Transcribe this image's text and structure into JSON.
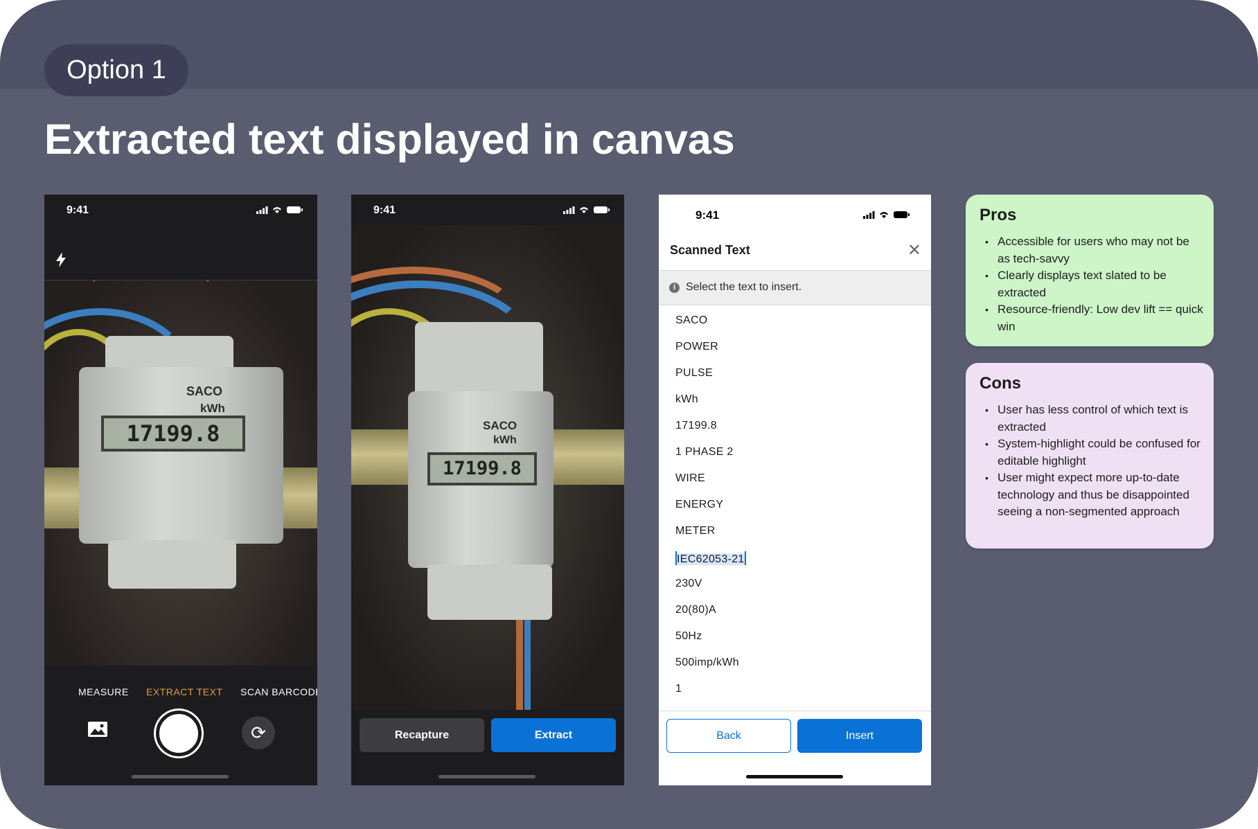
{
  "slide": {
    "option_label": "Option 1",
    "title": "Extracted text displayed in canvas"
  },
  "phone1": {
    "time": "9:41",
    "modes": [
      "MEASURE",
      "EXTRACT TEXT",
      "SCAN BARCODE"
    ],
    "active_mode": "EXTRACT TEXT",
    "meter_lcd": "17199.8",
    "meter_brand": "SACO",
    "meter_unit": "kWh"
  },
  "phone2": {
    "time": "9:41",
    "recapture_label": "Recapture",
    "extract_label": "Extract",
    "meter_lcd": "17199.8",
    "meter_brand": "SACO",
    "meter_unit": "kWh"
  },
  "phone3": {
    "time": "9:41",
    "sheet_title": "Scanned Text",
    "info_text": "Select the text to insert.",
    "items": [
      "SACO",
      "POWER",
      "PULSE",
      "kWh",
      "17199.8",
      "1 PHASE 2",
      "WIRE",
      "ENERGY",
      "METER",
      "IEC62053-21",
      "230V",
      "20(80)A",
      "50Hz",
      "500imp/kWh",
      "1"
    ],
    "selected_item": "IEC62053-21",
    "back_label": "Back",
    "insert_label": "Insert"
  },
  "pros": {
    "title": "Pros",
    "items": [
      "Accessible for users who may not be as tech-savvy",
      "Clearly displays text slated to be extracted",
      "Resource-friendly: Low dev lift == quick win"
    ]
  },
  "cons": {
    "title": "Cons",
    "items": [
      "User has less control of which text is extracted",
      "System-highlight could be confused for editable highlight",
      "User might expect more up-to-date technology and thus be disappointed seeing a non-segmented approach"
    ]
  },
  "colors": {
    "slide_bg": "#5a5d70",
    "pill_bg": "#3e3f56",
    "accent_blue": "#0a72d6",
    "active_mode": "#e49a3c",
    "pros_bg": "#cdf5c8",
    "cons_bg": "#efe1f3"
  }
}
